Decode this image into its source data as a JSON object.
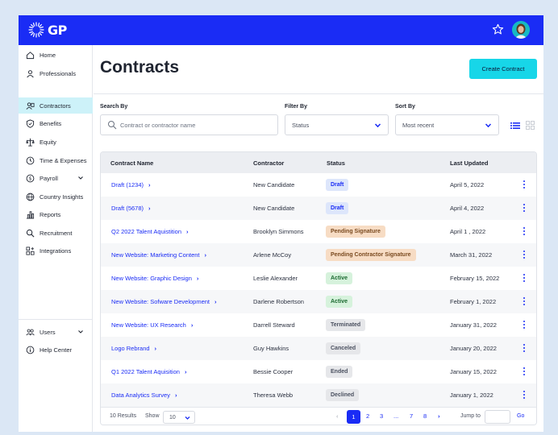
{
  "header": {
    "logo_text": "GP"
  },
  "sidebar": {
    "items": [
      {
        "label": "Home",
        "icon": "home-icon"
      },
      {
        "label": "Professionals",
        "icon": "person-icon"
      },
      {
        "label": "Contractors",
        "icon": "contractors-icon",
        "active": true
      },
      {
        "label": "Benefits",
        "icon": "shield-icon"
      },
      {
        "label": "Equity",
        "icon": "equity-icon"
      },
      {
        "label": "Time & Expenses",
        "icon": "clock-icon"
      },
      {
        "label": "Payroll",
        "icon": "dollar-icon"
      },
      {
        "label": "Country Insights",
        "icon": "globe-icon"
      },
      {
        "label": "Reports",
        "icon": "bar-chart-icon"
      },
      {
        "label": "Recruitment",
        "icon": "search-icon"
      },
      {
        "label": "Integrations",
        "icon": "integrations-icon"
      }
    ],
    "bottom": [
      {
        "label": "Users",
        "icon": "users-icon"
      },
      {
        "label": "Help Center",
        "icon": "info-icon"
      }
    ]
  },
  "main": {
    "title": "Contracts",
    "create_label": "Create Contract",
    "search_label": "Search By",
    "search_placeholder": "Contract or contractor name",
    "filter_label": "Filter By",
    "filter_value": "Status",
    "sort_label": "Sort By",
    "sort_value": "Most recent"
  },
  "table": {
    "headers": [
      "Contract Name",
      "Contractor",
      "Status",
      "Last Updated"
    ],
    "rows": [
      {
        "name": "Draft (1234)",
        "contractor": "New Candidate",
        "status": "Draft",
        "status_type": "draft",
        "updated": "April 5, 2022"
      },
      {
        "name": "Draft (5678)",
        "contractor": "New Candidate",
        "status": "Draft",
        "status_type": "draft",
        "updated": "April 4, 2022"
      },
      {
        "name": "Q2 2022 Talent Aquistition",
        "contractor": "Brooklyn Simmons",
        "status": "Pending Signature",
        "status_type": "pending",
        "updated": "April 1 , 2022"
      },
      {
        "name": "New Website: Marketing Content",
        "contractor": "Arlene McCoy",
        "status": "Pending Contractor Signature",
        "status_type": "pending",
        "updated": "March 31, 2022"
      },
      {
        "name": "New Website: Graphic Design",
        "contractor": "Leslie Alexander",
        "status": "Active",
        "status_type": "active",
        "updated": "February 15, 2022"
      },
      {
        "name": "New Website: Sofware Development",
        "contractor": "Darlene Robertson",
        "status": "Active",
        "status_type": "active",
        "updated": "February 1, 2022"
      },
      {
        "name": "New Website: UX Research",
        "contractor": "Darrell Steward",
        "status": "Terminated",
        "status_type": "neutral",
        "updated": "January 31, 2022"
      },
      {
        "name": "Logo Rebrand",
        "contractor": "Guy Hawkins",
        "status": "Canceled",
        "status_type": "neutral",
        "updated": "January 20, 2022"
      },
      {
        "name": "Q1 2022 Talent Aquisition",
        "contractor": "Bessie Cooper",
        "status": "Ended",
        "status_type": "neutral",
        "updated": "January 15, 2022"
      },
      {
        "name": "Data Analytics Survey",
        "contractor": "Theresa Webb",
        "status": "Declined",
        "status_type": "neutral",
        "updated": "January 1, 2022"
      }
    ]
  },
  "footer": {
    "results": "10 Results",
    "show_label": "Show",
    "show_value": "10",
    "pages": [
      "1",
      "2",
      "3",
      "...",
      "7",
      "8"
    ],
    "prev": "‹",
    "next": "›",
    "jump_label": "Jump to",
    "go_label": "Go"
  },
  "colors": {
    "brand": "#1a2cf5",
    "accent": "#17d6e8",
    "draft_bg": "#dde6fb",
    "draft_fg": "#1a2cf5",
    "pending_bg": "#f7dcc4",
    "pending_fg": "#7a4a1f",
    "active_bg": "#d6f2dc",
    "active_fg": "#1b6a30",
    "neutral_bg": "#e6e7ea",
    "neutral_fg": "#4b5160"
  }
}
